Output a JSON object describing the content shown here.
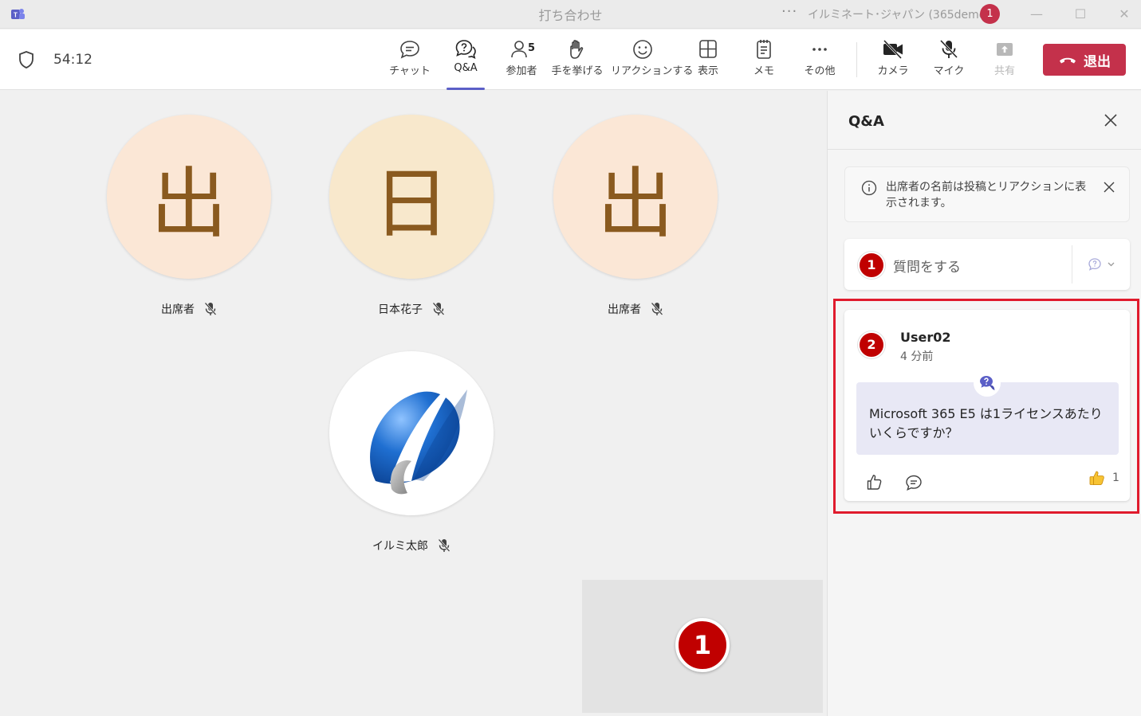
{
  "window": {
    "title": "打ち合わせ",
    "more_label": "···",
    "org_name": "イルミネート･ジャパン (365demo1)",
    "account_badge": "1"
  },
  "toolbar": {
    "timer": "54:12",
    "buttons": [
      {
        "label": "チャット",
        "icon": "chat-icon"
      },
      {
        "label": "Q&A",
        "icon": "qa-icon"
      },
      {
        "label": "参加者",
        "icon": "people-icon",
        "count": "5"
      },
      {
        "label": "手を挙げる",
        "icon": "raise-hand-icon"
      },
      {
        "label": "リアクションする",
        "icon": "reaction-icon"
      },
      {
        "label": "表示",
        "icon": "view-icon"
      },
      {
        "label": "メモ",
        "icon": "notes-icon"
      },
      {
        "label": "その他",
        "icon": "more-icon"
      },
      {
        "label": "カメラ",
        "icon": "camera-off-icon"
      },
      {
        "label": "マイク",
        "icon": "mic-off-icon"
      },
      {
        "label": "共有",
        "icon": "share-icon"
      }
    ],
    "active_tab": "Q&A",
    "leave_label": "退出"
  },
  "stage": {
    "participants": [
      {
        "initial": "出",
        "name": "出席者",
        "bg": "#fbe7d6",
        "muted": true
      },
      {
        "initial": "日",
        "name": "日本花子",
        "bg": "#f8e8cc",
        "muted": true
      },
      {
        "initial": "出",
        "name": "出席者",
        "bg": "#fbe7d6",
        "muted": true
      },
      {
        "initial": "",
        "name": "イルミ太郎",
        "bg": "#ffffff",
        "muted": true,
        "avatar": "company-logo"
      }
    ],
    "self_badge": "1"
  },
  "panel": {
    "title": "Q&A",
    "notice": "出席者の名前は投稿とリアクションに表示されます。",
    "ask_badge": "1",
    "ask_placeholder": "質問をする",
    "question": {
      "badge": "2",
      "user": "User02",
      "time": "4 分前",
      "text": "Microsoft 365 E5 は1ライセンスあたりいくらですか？",
      "reaction_count": "1"
    }
  },
  "colors": {
    "accent": "#5b5fc7",
    "leave": "#c4314b",
    "badge": "#c00000",
    "highlight": "#e01b2d"
  }
}
